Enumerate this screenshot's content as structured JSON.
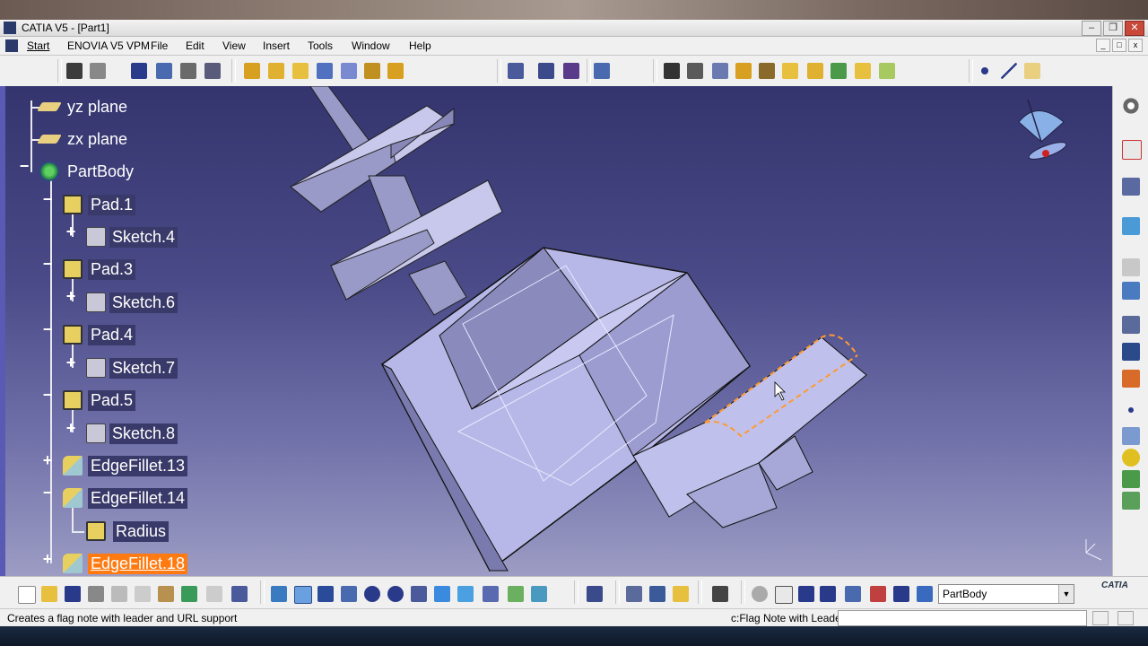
{
  "window": {
    "title": "CATIA V5 - [Part1]",
    "minimize": "–",
    "restore": "❐",
    "close": "✕"
  },
  "menubar": {
    "items": [
      "Start",
      "ENOVIA V5 VPM",
      "File",
      "Edit",
      "View",
      "Insert",
      "Tools",
      "Window",
      "Help"
    ]
  },
  "tree": {
    "nodes": [
      {
        "label": "yz plane",
        "icon": "plane-icon"
      },
      {
        "label": "zx plane",
        "icon": "plane-icon"
      },
      {
        "label": "PartBody",
        "icon": "partbody-gear-icon"
      },
      {
        "label": "Pad.1",
        "icon": "pad-icon"
      },
      {
        "label": "Sketch.4",
        "icon": "sketch-icon"
      },
      {
        "label": "Pad.3",
        "icon": "pad-icon"
      },
      {
        "label": "Sketch.6",
        "icon": "sketch-icon"
      },
      {
        "label": "Pad.4",
        "icon": "pad-icon"
      },
      {
        "label": "Sketch.7",
        "icon": "sketch-icon"
      },
      {
        "label": "Pad.5",
        "icon": "pad-icon"
      },
      {
        "label": "Sketch.8",
        "icon": "sketch-icon"
      },
      {
        "label": "EdgeFillet.13",
        "icon": "edgefillet-icon"
      },
      {
        "label": "EdgeFillet.14",
        "icon": "edgefillet-icon"
      },
      {
        "label": "Radius",
        "icon": "radius-parameter-icon"
      },
      {
        "label": "EdgeFillet.18",
        "icon": "edgefillet-icon"
      }
    ],
    "selected": "EdgeFillet.18"
  },
  "bottom_toolbar": {
    "body_selector": "PartBody"
  },
  "status": {
    "message": "Creates a flag note with leader and URL support",
    "command_label": "c:Flag Note with Leader",
    "command_value": ""
  },
  "brand": {
    "logo_text": "CATIA"
  },
  "colors": {
    "selection": "#ff7a10",
    "viewport_top": "#34346e",
    "viewport_bottom": "#9c9cc4",
    "part_face": "#b8b8e8",
    "fillet_edge": "#ff9a30"
  }
}
